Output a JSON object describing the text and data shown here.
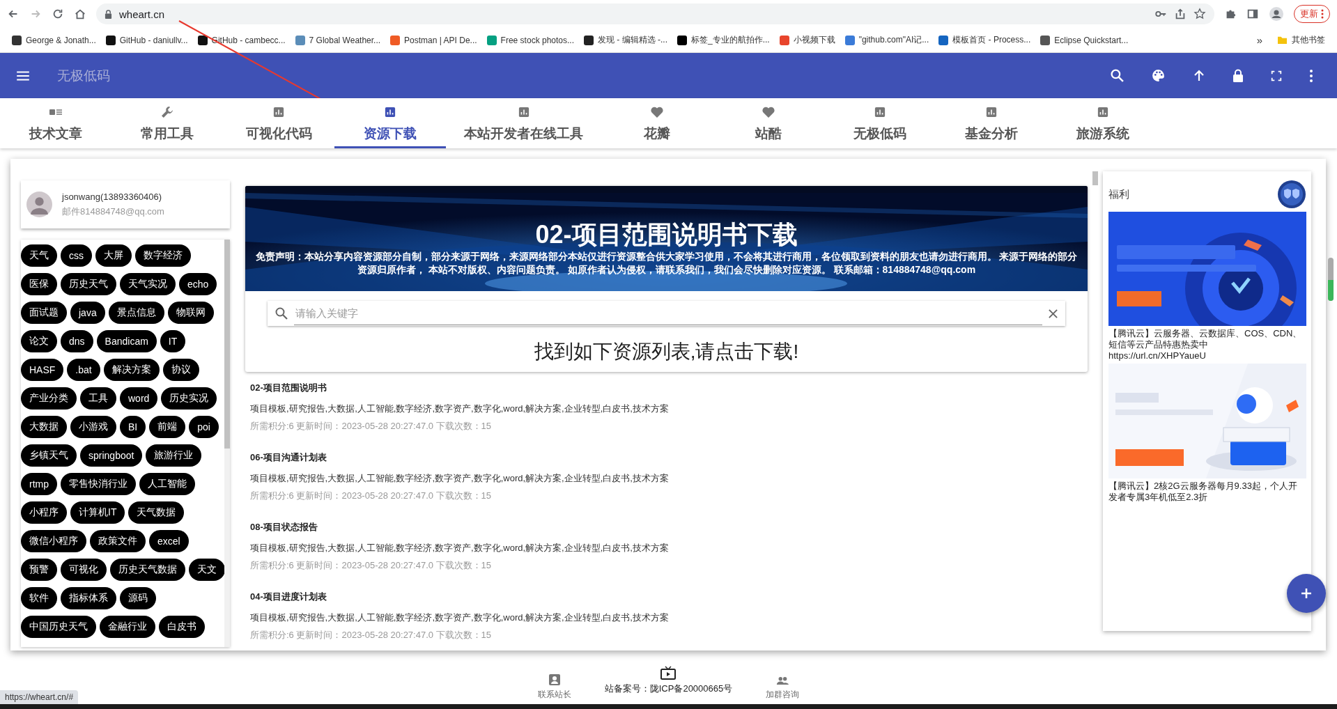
{
  "browser": {
    "url": "wheart.cn",
    "update_button": "更新",
    "bookmarks": [
      {
        "label": "George & Jonath...",
        "color": "#333333"
      },
      {
        "label": "GitHub - daniullv...",
        "color": "#111111"
      },
      {
        "label": "GitHub - cambecc...",
        "color": "#111111"
      },
      {
        "label": "7 Global Weather...",
        "color": "#5b8db8"
      },
      {
        "label": "Postman | API De...",
        "color": "#ef5b25"
      },
      {
        "label": "Free stock photos...",
        "color": "#05a081"
      },
      {
        "label": "发现 - 编辑精选 -...",
        "color": "#222222"
      },
      {
        "label": "标签_专业的航拍作...",
        "color": "#000000"
      },
      {
        "label": "小视频下载",
        "color": "#e8452c"
      },
      {
        "label": "\"github.com\"AI记...",
        "color": "#3b7bd8"
      },
      {
        "label": "模板首页 - Process...",
        "color": "#1565c0"
      },
      {
        "label": "Eclipse Quickstart...",
        "color": "#555555"
      }
    ],
    "more": "»",
    "other_bookmarks": "其他书签",
    "status_link": "https://wheart.cn/#"
  },
  "header": {
    "title": "无极低码"
  },
  "tabs": [
    {
      "label": "技术文章",
      "selected": false
    },
    {
      "label": "常用工具",
      "selected": false
    },
    {
      "label": "可视化代码",
      "selected": false
    },
    {
      "label": "资源下载",
      "selected": true
    },
    {
      "label": "本站开发者在线工具",
      "selected": false
    },
    {
      "label": "花瓣",
      "selected": false
    },
    {
      "label": "站酷",
      "selected": false
    },
    {
      "label": "无极低码",
      "selected": false
    },
    {
      "label": "基金分析",
      "selected": false
    },
    {
      "label": "旅游系统",
      "selected": false
    }
  ],
  "profile": {
    "name": "jsonwang(13893360406)",
    "email": "邮件814884748@qq.com"
  },
  "tags": [
    "天气",
    "css",
    "大屏",
    "数字经济",
    "医保",
    "历史天气",
    "天气实况",
    "echo",
    "面试题",
    "java",
    "景点信息",
    "物联网",
    "论文",
    "dns",
    "Bandicam",
    "IT",
    "HASF",
    ".bat",
    "解决方案",
    "协议",
    "产业分类",
    "工具",
    "word",
    "历史实况",
    "大数据",
    "小游戏",
    "BI",
    "前端",
    "poi",
    "乡镇天气",
    "springboot",
    "旅游行业",
    "rtmp",
    "零售快消行业",
    "人工智能",
    "小程序",
    "计算机IT",
    "天气数据",
    "微信小程序",
    "政策文件",
    "excel",
    "预警",
    "可视化",
    "历史天气数据",
    "天文",
    "软件",
    "指标体系",
    "源码",
    "中国历史天气",
    "金融行业",
    "白皮书"
  ],
  "banner": {
    "title": "02-项目范围说明书下载",
    "disclaimer": "免责声明：本站分享内容资源部分自制，部分来源于网络，来源网络部分本站仅进行资源整合供大家学习使用，不会将其进行商用，各位领取到资料的朋友也请勿进行商用。 来源于网络的部分资源归原作者， 本站不对版权、内容问题负责。 如原作者认为侵权，请联系我们，我们会尽快删除对应资源。 联系邮箱：814884748@qq.com"
  },
  "search": {
    "placeholder": "请输入关键字"
  },
  "results_heading": "找到如下资源列表,请点击下载!",
  "resources": [
    {
      "title": "02-项目范围说明书",
      "tags": "项目模板,研究报告,大数据,人工智能,数字经济,数字资产,数字化,word,解决方案,企业转型,白皮书,技术方案",
      "meta": "所需积分:6 更新时间：2023-05-28 20:27:47.0 下载次数：15"
    },
    {
      "title": "06-项目沟通计划表",
      "tags": "项目模板,研究报告,大数据,人工智能,数字经济,数字资产,数字化,word,解决方案,企业转型,白皮书,技术方案",
      "meta": "所需积分:6 更新时间：2023-05-28 20:27:47.0 下载次数：15"
    },
    {
      "title": "08-项目状态报告",
      "tags": "项目模板,研究报告,大数据,人工智能,数字经济,数字资产,数字化,word,解决方案,企业转型,白皮书,技术方案",
      "meta": "所需积分:6 更新时间：2023-05-28 20:27:47.0 下载次数：15"
    },
    {
      "title": "04-项目进度计划表",
      "tags": "项目模板,研究报告,大数据,人工智能,数字经济,数字资产,数字化,word,解决方案,企业转型,白皮书,技术方案",
      "meta": "所需积分:6 更新时间：2023-05-28 20:27:47.0 下载次数：15"
    }
  ],
  "promo": {
    "title": "福利",
    "ads": [
      {
        "kind": "picture",
        "caption": "【腾讯云】云服务器、云数据库、COS、CDN、短信等云产品特惠热卖中 https://url.cn/XHPYaueU"
      },
      {
        "kind": "picture",
        "caption": "【腾讯云】2核2G云服务器每月9.33起，个人开发者专属3年机低至2.3折"
      }
    ]
  },
  "footer": {
    "contact": "联系站长",
    "icp": "站备案号：陇ICP备20000665号",
    "group": "加群咨询"
  }
}
